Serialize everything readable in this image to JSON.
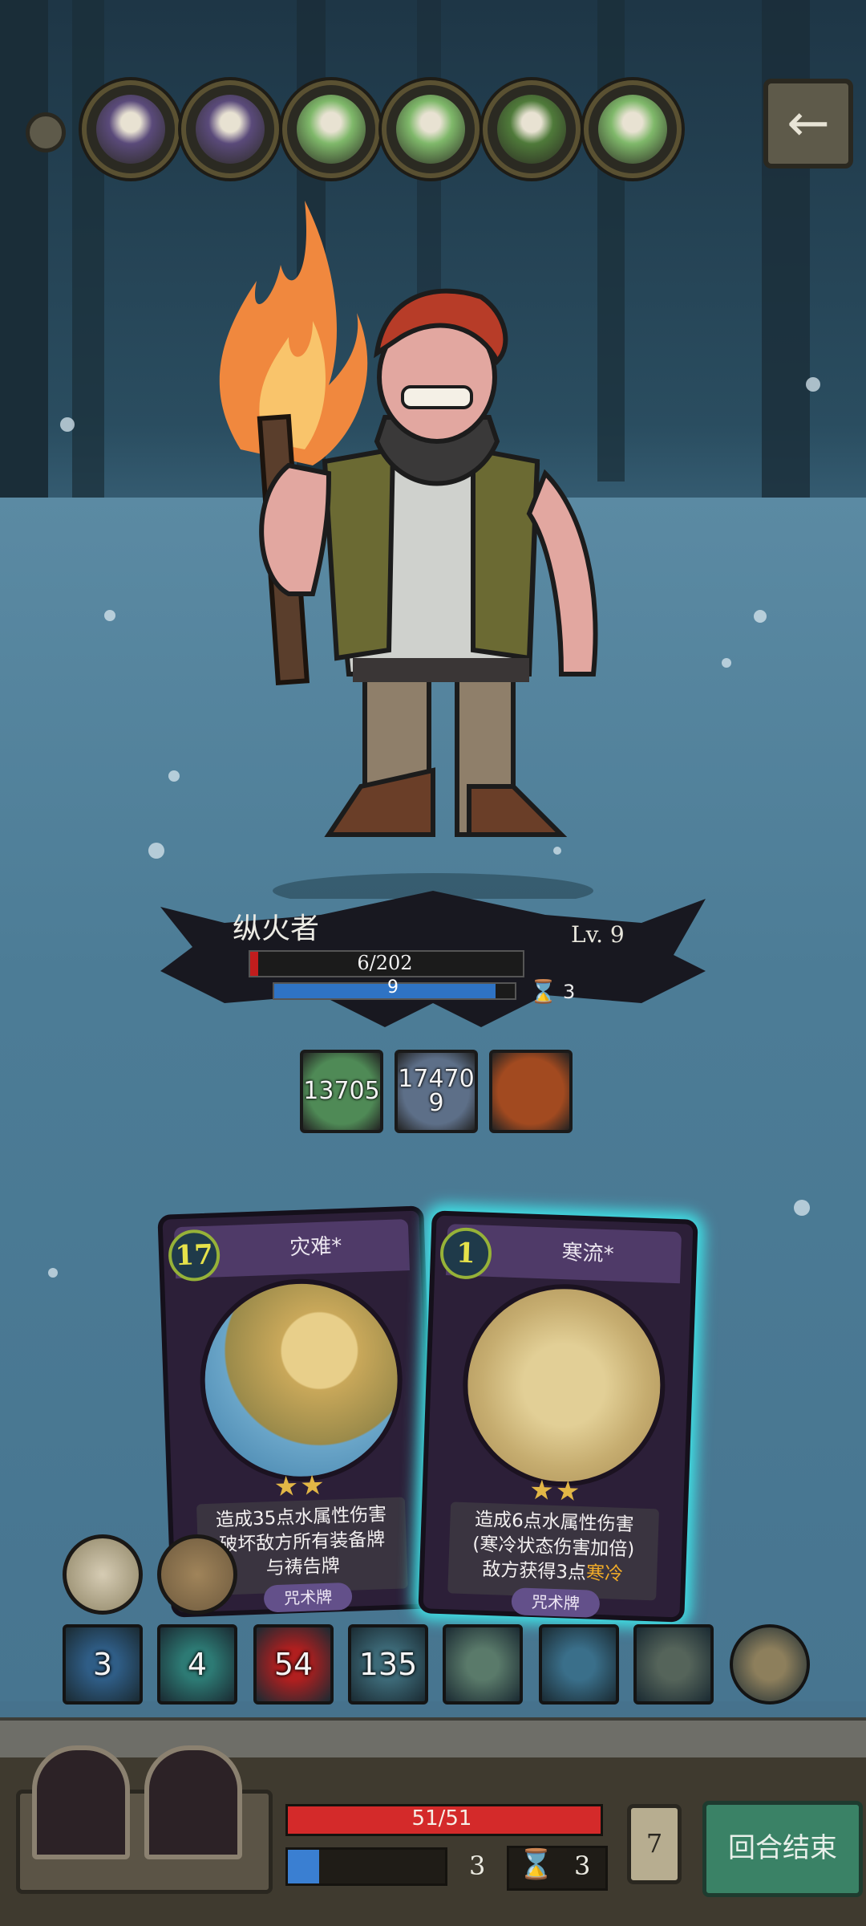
{
  "enemy_queue": {
    "portraits": [
      {
        "icon": "bearded-wizard-portrait",
        "color": "#5a4a7a"
      },
      {
        "icon": "bearded-wizard-portrait",
        "color": "#5a4a7a"
      },
      {
        "icon": "green-robot-portrait",
        "color": "#7fb86a"
      },
      {
        "icon": "green-robot-portrait",
        "color": "#7fb86a"
      },
      {
        "icon": "hooded-plant-creature-portrait",
        "color": "#4f7a3a"
      },
      {
        "icon": "green-robot-portrait",
        "color": "#7fb86a"
      }
    ],
    "back_icon": "←"
  },
  "enemy": {
    "name": "纵火者",
    "level": "Lv. 9",
    "hp_text": "6/202",
    "hp_fraction": 0.03,
    "shield_text": "9",
    "shield_fraction": 0.92,
    "hourglass_icon": "⌛",
    "timer": "3"
  },
  "status_effects": [
    {
      "icon": "green-poison-skull-icon",
      "text": "13705",
      "color": "#4f8a56"
    },
    {
      "icon": "frost-shards-icon",
      "text": "17470\n9",
      "color": "#5d6f88"
    },
    {
      "icon": "fire-fence-icon",
      "text": "",
      "color": "#a24a20"
    }
  ],
  "cards": [
    {
      "cost": "17",
      "name": "灾难*",
      "stars": "★★",
      "desc": "造成35点水属性伤害\n破坏敌方所有装备牌\n与祷告牌",
      "type": "咒术牌",
      "art_icon": "great-wave-icon",
      "selected": false
    },
    {
      "cost": "1",
      "name": "寒流*",
      "stars": "★★",
      "desc_pre": "造成6点水属性伤害\n(寒冷状态伤害加倍)\n敌方获得3点",
      "desc_hl": "寒冷",
      "type": "咒术牌",
      "art_icon": "frozen-tree-icon",
      "selected": true
    }
  ],
  "relics": [
    {
      "icon": "fanged-monster-relic-icon"
    },
    {
      "icon": "wooden-staff-relic-icon"
    }
  ],
  "skills": [
    {
      "icon": "lightning-orb-icon",
      "count": "3",
      "color": "#2f5d86"
    },
    {
      "icon": "teal-spikes-icon",
      "count": "4",
      "color": "#2d7a74"
    },
    {
      "icon": "fire-spiral-icon",
      "count": "54",
      "color": "#b01f1f"
    },
    {
      "icon": "water-vortex-icon",
      "count": "135",
      "color": "#3d6a78"
    },
    {
      "icon": "crystal-burst-icon",
      "count": "",
      "color": "#5a7a6a"
    },
    {
      "icon": "blue-splash-icon",
      "count": "",
      "color": "#3a6f8a"
    },
    {
      "icon": "old-man-portrait-icon",
      "count": "",
      "color": "#55645a"
    },
    {
      "icon": "crossbow-icon",
      "count": "",
      "color": "#8d7f5c"
    }
  ],
  "player": {
    "hp_text": "51/51",
    "hp_fraction": 1.0,
    "shield_fraction": 0.2,
    "shield_value": "3",
    "hourglass_icon": "⌛",
    "timer": "3",
    "deck_count": "7",
    "end_turn_label": "回合结束"
  }
}
